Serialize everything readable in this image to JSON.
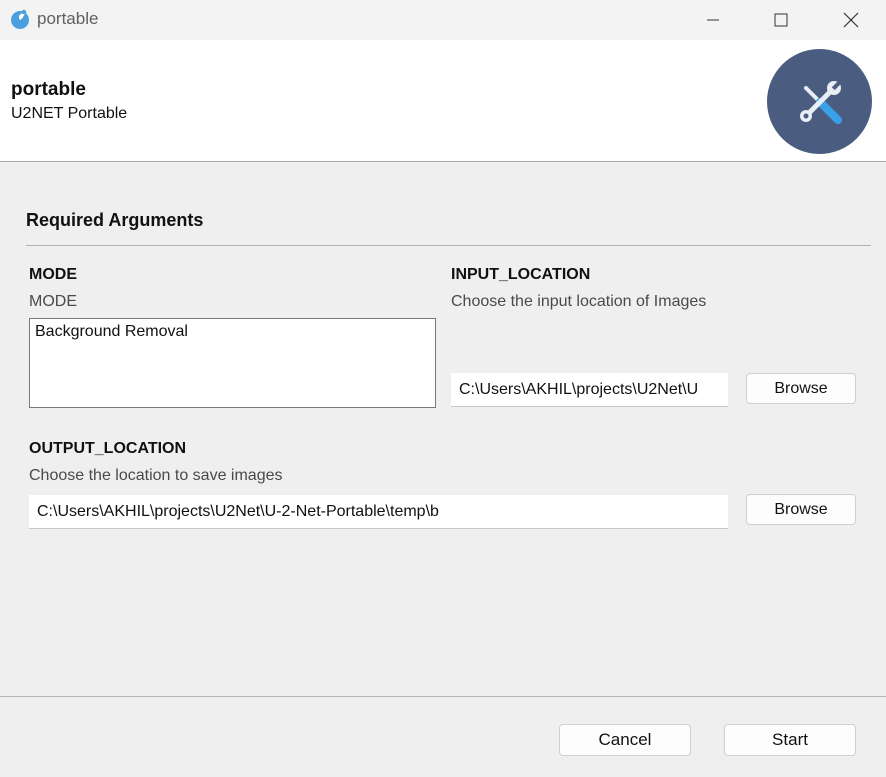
{
  "window": {
    "title": "portable",
    "app_icon": "python-icon",
    "controls": {
      "minimize": "minimize-icon",
      "maximize": "maximize-icon",
      "close": "close-icon"
    }
  },
  "header": {
    "title": "portable",
    "subtitle": "U2NET Portable",
    "logo_icon": "tools-icon",
    "logo_color": "#4a5d80"
  },
  "section": {
    "title": "Required Arguments"
  },
  "mode": {
    "label": "MODE",
    "help": "MODE",
    "options": [
      "Background Removal"
    ]
  },
  "input_location": {
    "label": "INPUT_LOCATION",
    "help": "Choose the input location of Images",
    "value": "C:\\Users\\AKHIL\\projects\\U2Net\\U",
    "browse_label": "Browse"
  },
  "output_location": {
    "label": "OUTPUT_LOCATION",
    "help": "Choose the location to save images",
    "value": "C:\\Users\\AKHIL\\projects\\U2Net\\U-2-Net-Portable\\temp\\b",
    "browse_label": "Browse"
  },
  "footer": {
    "cancel_label": "Cancel",
    "start_label": "Start"
  }
}
